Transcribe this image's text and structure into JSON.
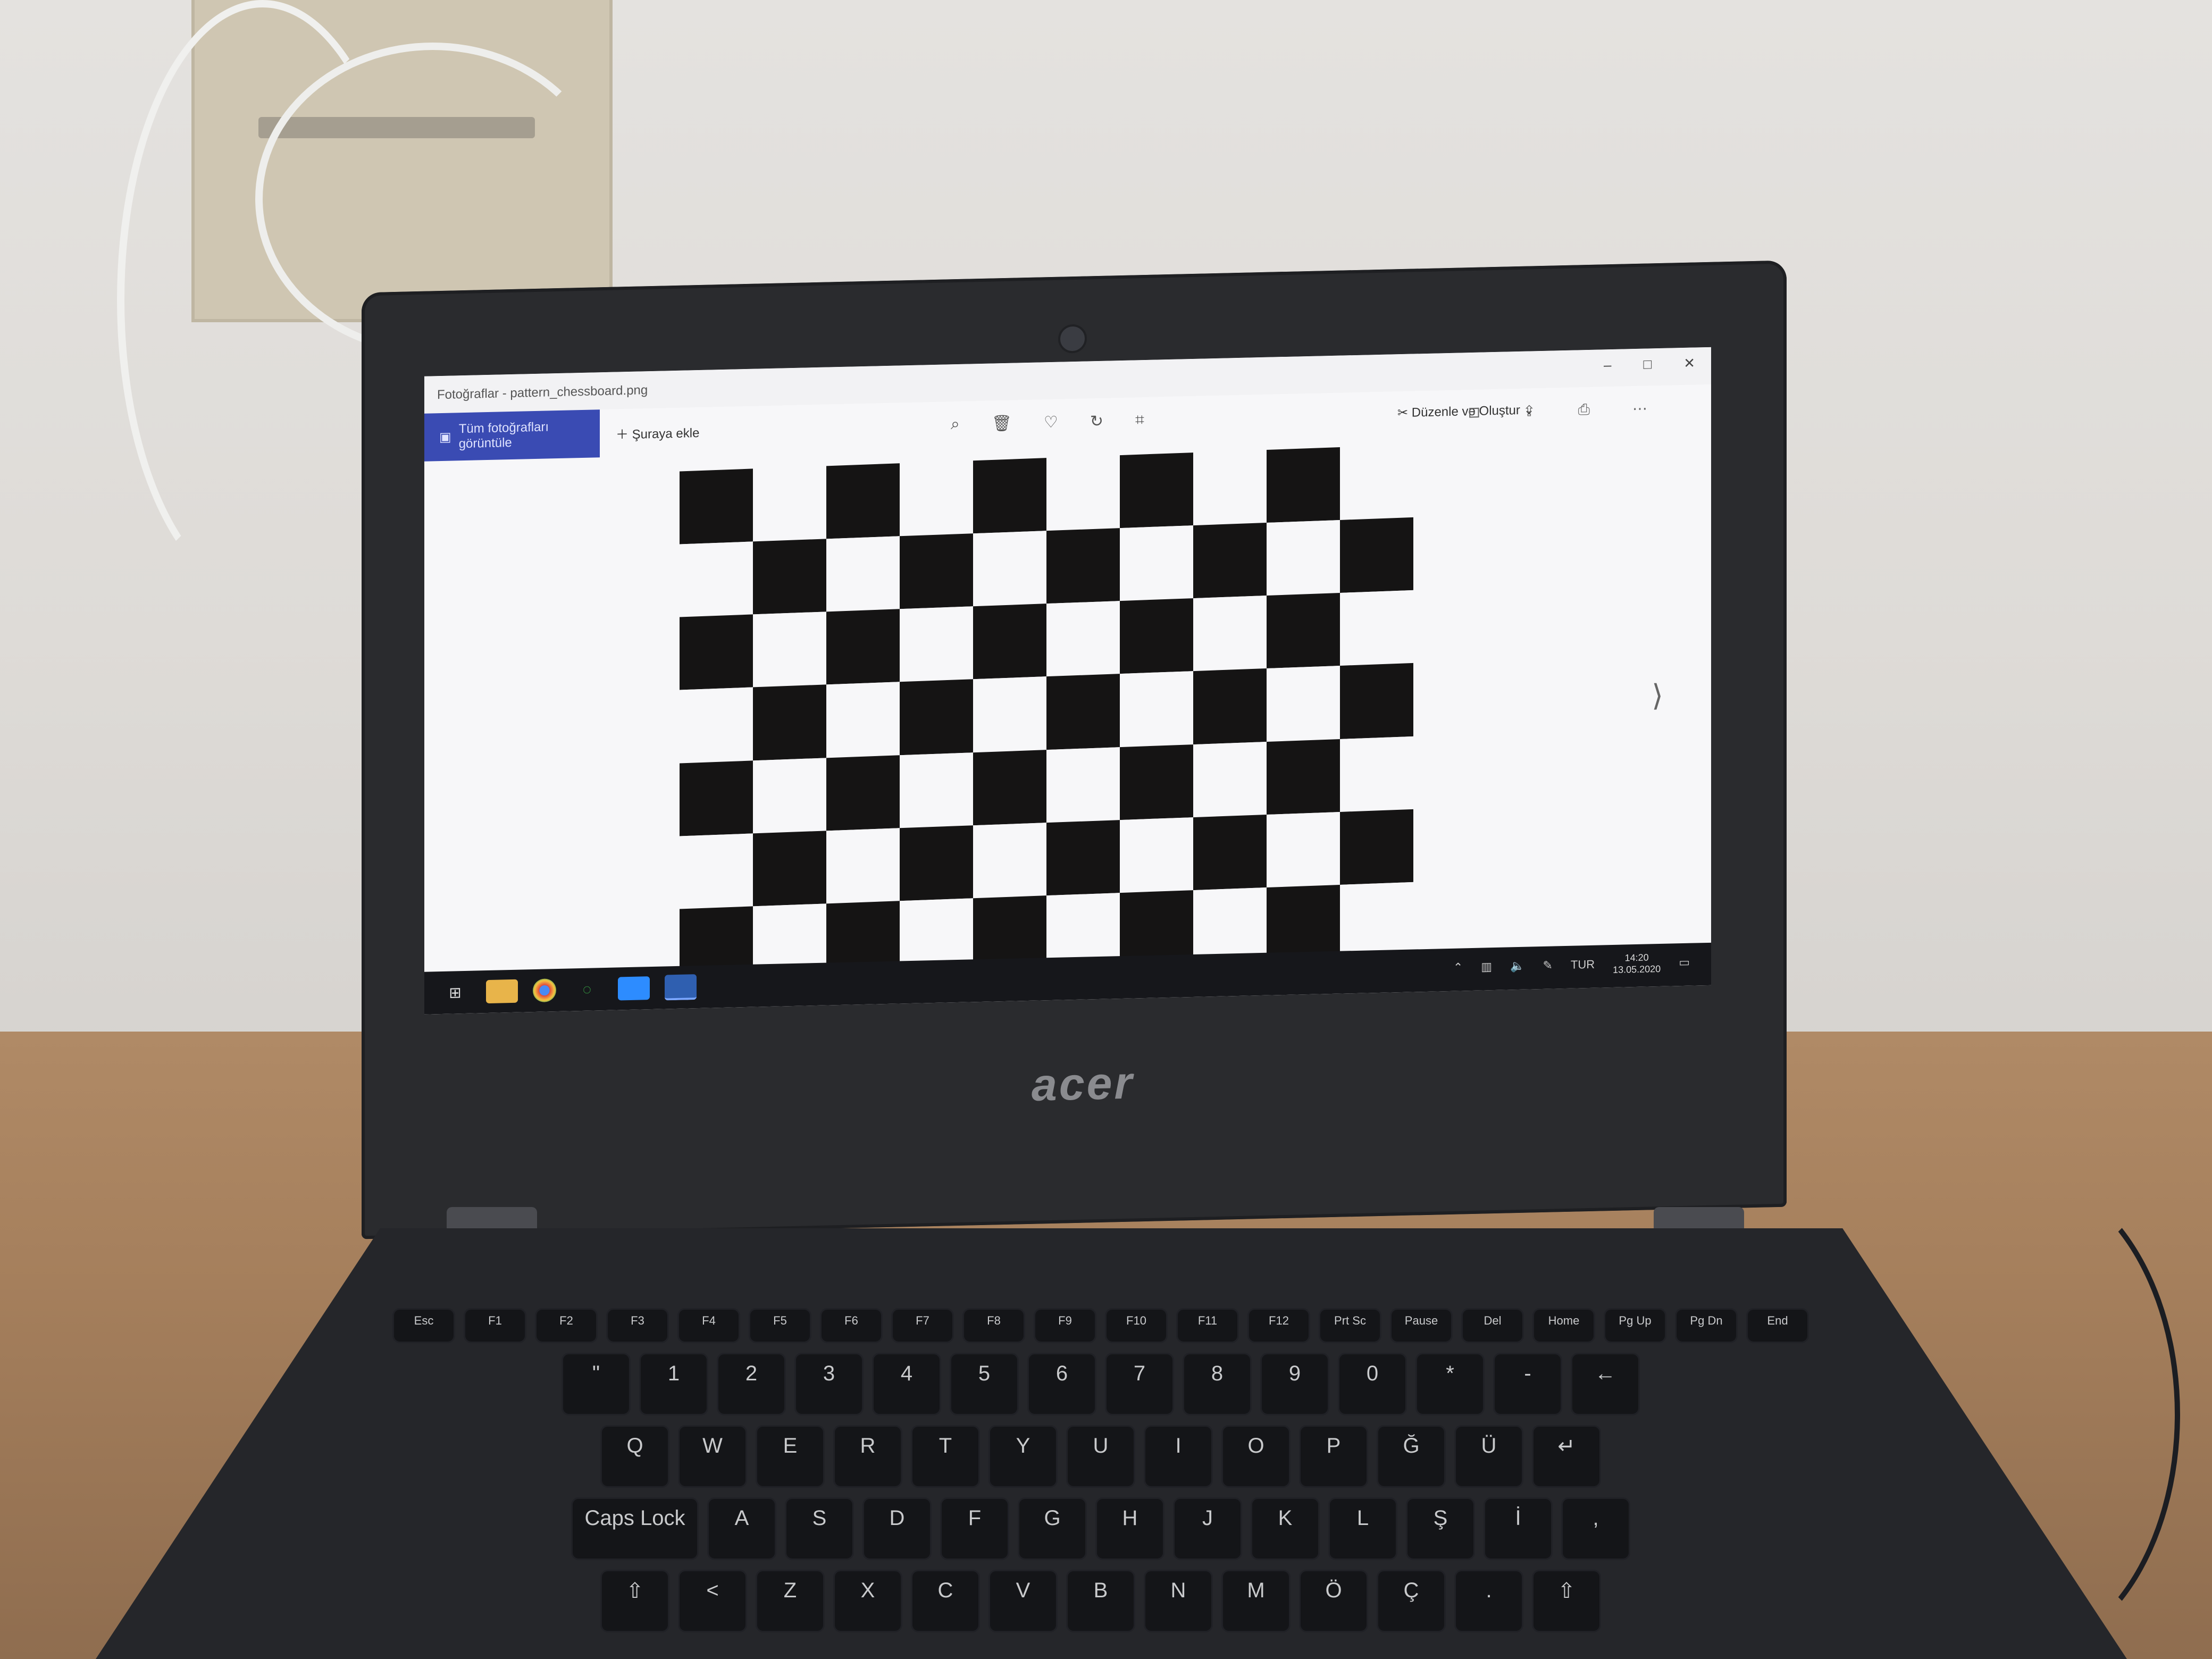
{
  "window": {
    "title": "Fotoğraflar - pattern_chessboard.png",
    "controls": [
      "–",
      "□",
      "✕"
    ]
  },
  "toolbar": {
    "all_photos_label": "Tüm fotoğrafları görüntüle",
    "add_label": "Şuraya ekle",
    "tool_icons": [
      "zoom-icon",
      "delete-icon",
      "favorite-icon",
      "rotate-icon",
      "crop-icon"
    ],
    "edit_label": "Düzenle ve Oluştur",
    "right_icons": [
      "enhance-icon",
      "share-icon",
      "print-icon",
      "more-icon"
    ]
  },
  "content": {
    "image_type": "chessboard-pattern",
    "rows": 7,
    "columns": 10
  },
  "taskbar": {
    "apps": [
      "windows-start-icon",
      "file-explorer-icon",
      "chrome-icon",
      "spinner-app-icon",
      "zoom-app-icon",
      "photos-app-icon"
    ],
    "tray_language": "TUR",
    "time": "14:20",
    "date": "13.05.2020"
  },
  "laptop": {
    "brand": "acer"
  },
  "keyboard": {
    "rows": [
      [
        "Esc",
        "F1",
        "F2",
        "F3",
        "F4",
        "F5",
        "F6",
        "F7",
        "F8",
        "F9",
        "F10",
        "F11",
        "F12",
        "Prt Sc",
        "Pause",
        "Del",
        "Home",
        "Pg Up",
        "Pg Dn",
        "End"
      ],
      [
        "\"",
        "1",
        "2",
        "3",
        "4",
        "5",
        "6",
        "7",
        "8",
        "9",
        "0",
        "*",
        "-",
        "←"
      ],
      [
        "Q",
        "W",
        "E",
        "R",
        "T",
        "Y",
        "U",
        "I",
        "O",
        "P",
        "Ğ",
        "Ü",
        "↵"
      ],
      [
        "Caps Lock",
        "A",
        "S",
        "D",
        "F",
        "G",
        "H",
        "J",
        "K",
        "L",
        "Ş",
        "İ",
        ","
      ],
      [
        "⇧",
        "<",
        "Z",
        "X",
        "C",
        "V",
        "B",
        "N",
        "M",
        "Ö",
        "Ç",
        ".",
        "⇧"
      ]
    ]
  },
  "colors": {
    "accent_button": "#3a4bb3",
    "chess_dark": "#151414",
    "chess_light": "#f7f7f9",
    "taskbar": "#16171b",
    "laptop_body": "#2a2b2e"
  }
}
